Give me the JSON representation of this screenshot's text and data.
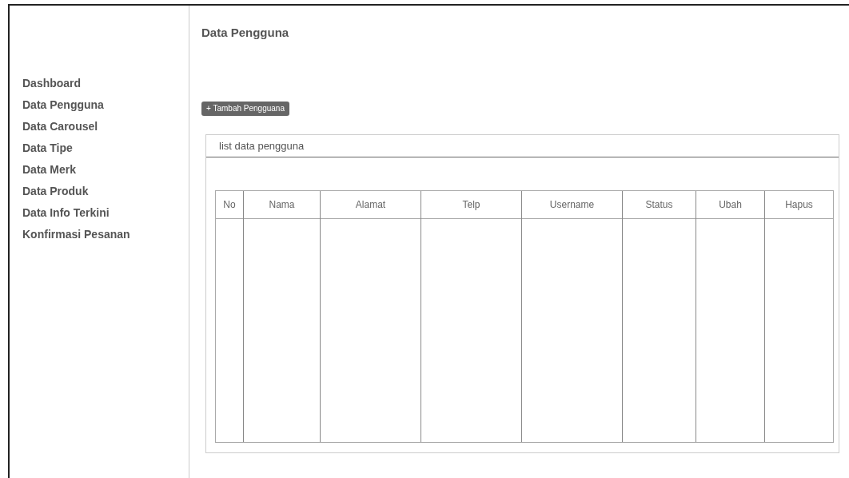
{
  "sidebar": {
    "items": [
      {
        "label": "Dashboard"
      },
      {
        "label": "Data Pengguna"
      },
      {
        "label": "Data Carousel"
      },
      {
        "label": "Data Tipe"
      },
      {
        "label": "Data Merk"
      },
      {
        "label": "Data Produk"
      },
      {
        "label": "Data Info Terkini"
      },
      {
        "label": "Konfirmasi Pesanan"
      }
    ]
  },
  "page_title": "Data Pengguna",
  "add_button": "+ Tambah Pengguana",
  "card": {
    "title": "list data pengguna",
    "table": {
      "columns": [
        "No",
        "Nama",
        "Alamat",
        "Telp",
        "Username",
        "Status",
        "Ubah",
        "Hapus"
      ]
    }
  }
}
